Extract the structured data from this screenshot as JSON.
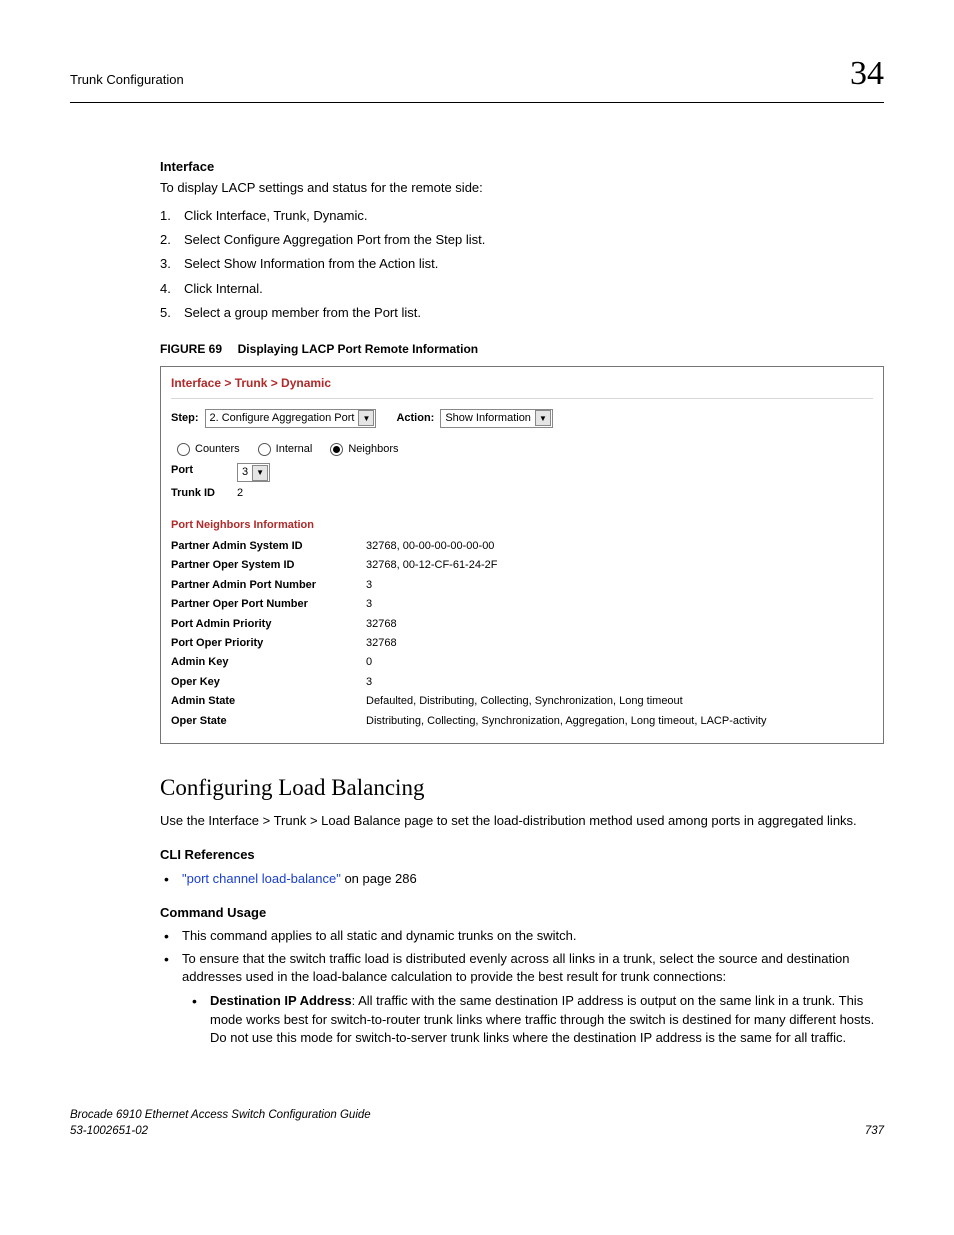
{
  "header": {
    "running_title": "Trunk Configuration",
    "chapter_number": "34"
  },
  "interface_section": {
    "heading": "Interface",
    "intro": "To display LACP settings and status for the remote side:",
    "steps": [
      "Click Interface, Trunk, Dynamic.",
      "Select Configure Aggregation Port from the Step list.",
      "Select Show Information from the Action list.",
      "Click Internal.",
      "Select a group member from the Port list."
    ]
  },
  "figure": {
    "label": "FIGURE 69",
    "title": "Displaying LACP Port Remote Information"
  },
  "screenshot": {
    "breadcrumb": "Interface > Trunk > Dynamic",
    "step_label": "Step:",
    "step_value": "2. Configure Aggregation Port",
    "action_label": "Action:",
    "action_value": "Show Information",
    "radios": {
      "counters": "Counters",
      "internal": "Internal",
      "neighbors": "Neighbors"
    },
    "port_label": "Port",
    "port_value": "3",
    "trunk_label": "Trunk ID",
    "trunk_value": "2",
    "section_title": "Port Neighbors Information",
    "rows": [
      {
        "k": "Partner Admin System ID",
        "v": "32768, 00-00-00-00-00-00"
      },
      {
        "k": "Partner Oper System ID",
        "v": "32768, 00-12-CF-61-24-2F"
      },
      {
        "k": "Partner Admin Port Number",
        "v": "3"
      },
      {
        "k": "Partner Oper Port Number",
        "v": "3"
      },
      {
        "k": "Port Admin Priority",
        "v": "32768"
      },
      {
        "k": "Port Oper Priority",
        "v": "32768"
      },
      {
        "k": "Admin Key",
        "v": "0"
      },
      {
        "k": "Oper Key",
        "v": "3"
      },
      {
        "k": "Admin State",
        "v": "Defaulted, Distributing, Collecting, Synchronization, Long timeout"
      },
      {
        "k": "Oper State",
        "v": "Distributing, Collecting, Synchronization, Aggregation, Long timeout, LACP-activity"
      }
    ]
  },
  "loadbal": {
    "heading": "Configuring Load Balancing",
    "intro": "Use the Interface > Trunk > Load Balance page to set the load-distribution method used among ports in aggregated links.",
    "cli_heading": "CLI References",
    "cli_link_text": "\"port channel load-balance\"",
    "cli_link_suffix": " on page 286",
    "cmd_heading": "Command Usage",
    "bullets": [
      "This command applies to all static and dynamic trunks on the switch.",
      "To ensure that the switch traffic load is distributed evenly across all links in a trunk, select the source and destination addresses used in the load-balance calculation to provide the best result for trunk connections:"
    ],
    "sub_bullet_label": "Destination IP Address",
    "sub_bullet_text": ": All traffic with the same destination IP address is output on the same link in a trunk. This mode works best for switch-to-router trunk links where traffic through the switch is destined for many different hosts. Do not use this mode for switch-to-server trunk links where the destination IP address is the same for all traffic."
  },
  "footer": {
    "line1": "Brocade 6910 Ethernet Access Switch Configuration Guide",
    "line2": "53-1002651-02",
    "page": "737"
  }
}
